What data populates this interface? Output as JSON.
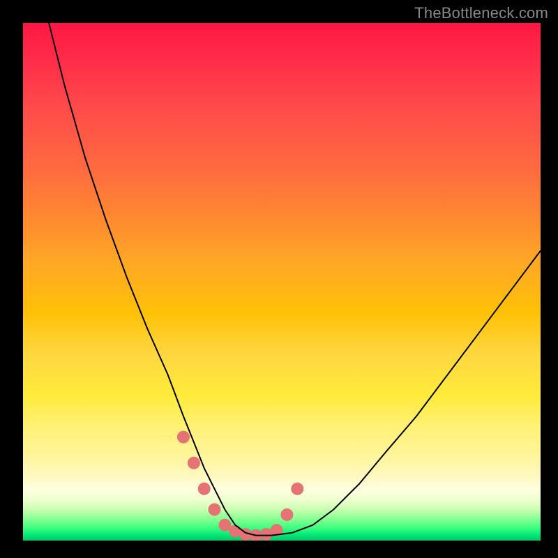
{
  "watermark": "TheBottleneck.com",
  "chart_data": {
    "type": "line",
    "title": "",
    "xlabel": "",
    "ylabel": "",
    "xlim": [
      0,
      100
    ],
    "ylim": [
      0,
      100
    ],
    "series": [
      {
        "name": "bottleneck-curve",
        "x": [
          5,
          8,
          12,
          16,
          20,
          24,
          28,
          31,
          33,
          35,
          37,
          39,
          41,
          43,
          45,
          48,
          52,
          56,
          60,
          65,
          70,
          76,
          82,
          88,
          94,
          100
        ],
        "y": [
          100,
          88,
          74,
          62,
          51,
          41,
          32,
          24,
          19,
          14,
          10,
          6,
          3,
          1.5,
          1,
          1,
          1.5,
          3,
          6,
          11,
          17,
          24,
          32,
          40,
          48,
          56
        ],
        "color": "#000000",
        "width": 2
      }
    ],
    "highlights": {
      "name": "marker-dots",
      "color": "#e57373",
      "radius": 9,
      "points_x": [
        31,
        33,
        35,
        37,
        39,
        41,
        43,
        45,
        47,
        49,
        51,
        53
      ],
      "points_y": [
        20,
        15,
        10,
        6,
        3,
        1.8,
        1.2,
        1,
        1.2,
        2,
        5,
        10
      ]
    },
    "gradient_stops": [
      {
        "pos": 0,
        "color": "#ff1744"
      },
      {
        "pos": 50,
        "color": "#ffc107"
      },
      {
        "pos": 75,
        "color": "#ffeb3b"
      },
      {
        "pos": 92,
        "color": "#fffde7"
      },
      {
        "pos": 100,
        "color": "#00e676"
      }
    ]
  }
}
